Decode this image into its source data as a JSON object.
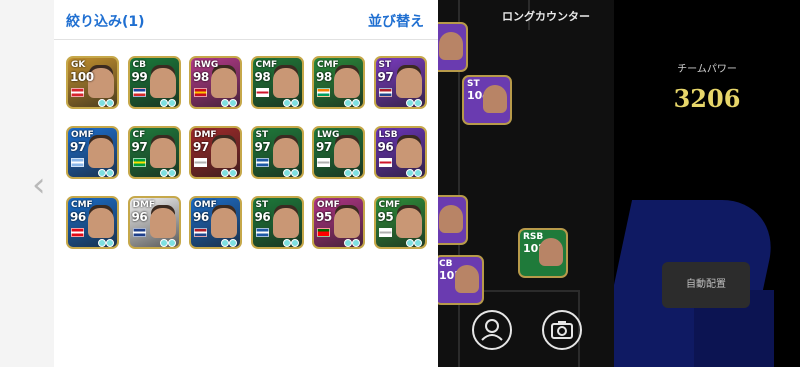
{
  "panel": {
    "filter_label": "絞り込み(1)",
    "sort_label": "並び替え"
  },
  "players": [
    {
      "pos": "GK",
      "rating": "100",
      "bg": "#c2902e",
      "flag": [
        "#d7252e",
        "#ffffff",
        "#d7252e"
      ]
    },
    {
      "pos": "CB",
      "rating": "99",
      "bg": "#1a7a3a",
      "flag": [
        "#1a43a0",
        "#ffffff",
        "#d42a2a"
      ]
    },
    {
      "pos": "RWG",
      "rating": "98",
      "bg": "#b53a8a",
      "flag": [
        "#c60b1e",
        "#ffc400",
        "#c60b1e"
      ]
    },
    {
      "pos": "CMF",
      "rating": "98",
      "bg": "#1f7a38",
      "flag": [
        "#ffffff",
        "#cf142b",
        "#ffffff"
      ]
    },
    {
      "pos": "CMF",
      "rating": "98",
      "bg": "#2a8a3a",
      "flag": [
        "#f77f00",
        "#ffffff",
        "#009e60"
      ]
    },
    {
      "pos": "ST",
      "rating": "97",
      "bg": "#7a3bbf",
      "flag": [
        "#ae1c28",
        "#ffffff",
        "#21468b"
      ]
    },
    {
      "pos": "OMF",
      "rating": "97",
      "bg": "#1d6fd0",
      "flag": [
        "#8ab6e8",
        "#ffffff",
        "#8ab6e8"
      ]
    },
    {
      "pos": "CF",
      "rating": "97",
      "bg": "#1e7b3c",
      "flag": [
        "#009c3b",
        "#ffdf00",
        "#009c3b"
      ]
    },
    {
      "pos": "DMF",
      "rating": "97",
      "bg": "#a02a2a",
      "flag": [
        "#ffffff",
        "#b0b0b0",
        "#ffffff"
      ]
    },
    {
      "pos": "ST",
      "rating": "97",
      "bg": "#1f7a3a",
      "flag": [
        "#1f5aa6",
        "#ffffff",
        "#1f5aa6"
      ]
    },
    {
      "pos": "LWG",
      "rating": "97",
      "bg": "#1f7a3a",
      "flag": [
        "#ffffff",
        "#b0b0b0",
        "#ffffff"
      ]
    },
    {
      "pos": "LSB",
      "rating": "96",
      "bg": "#6b35b8",
      "flag": [
        "#ffffff",
        "#cf142b",
        "#ffffff"
      ]
    },
    {
      "pos": "CMF",
      "rating": "96",
      "bg": "#1a6cc8",
      "flag": [
        "#e30a17",
        "#ffffff",
        "#e30a17"
      ]
    },
    {
      "pos": "DMF",
      "rating": "96",
      "bg": "#f3f3f3",
      "flag": [
        "#1f3f8a",
        "#ffffff",
        "#1f3f8a"
      ]
    },
    {
      "pos": "OMF",
      "rating": "96",
      "bg": "#1c6cc6",
      "flag": [
        "#ae1c28",
        "#ffffff",
        "#21468b"
      ]
    },
    {
      "pos": "ST",
      "rating": "96",
      "bg": "#1d7a3a",
      "flag": [
        "#1f5aa6",
        "#ffffff",
        "#1f5aa6"
      ]
    },
    {
      "pos": "OMF",
      "rating": "95",
      "bg": "#b13585",
      "flag": [
        "#006600",
        "#ff0000",
        "#ff0000"
      ]
    },
    {
      "pos": "CMF",
      "rating": "95",
      "bg": "#2e8f3a",
      "flag": [
        "#ffffff",
        "#b0b0b0",
        "#ffffff"
      ]
    }
  ],
  "field": {
    "label": "ロングカウンター",
    "cards": [
      {
        "pos": "ST",
        "rating": "104",
        "bg": "#6a3bb0"
      },
      {
        "pos": "RSB",
        "rating": "102",
        "bg": "#1f7a3a"
      },
      {
        "pos": "CB",
        "rating": "105",
        "bg": "#6a3bb0"
      }
    ]
  },
  "right": {
    "team_power_label": "チームパワー",
    "team_power_value": "3206",
    "auto_button_label": "自動配置"
  },
  "icons": {
    "back": "chevron-left-icon",
    "player": "person-icon",
    "screenshot": "camera-icon"
  }
}
